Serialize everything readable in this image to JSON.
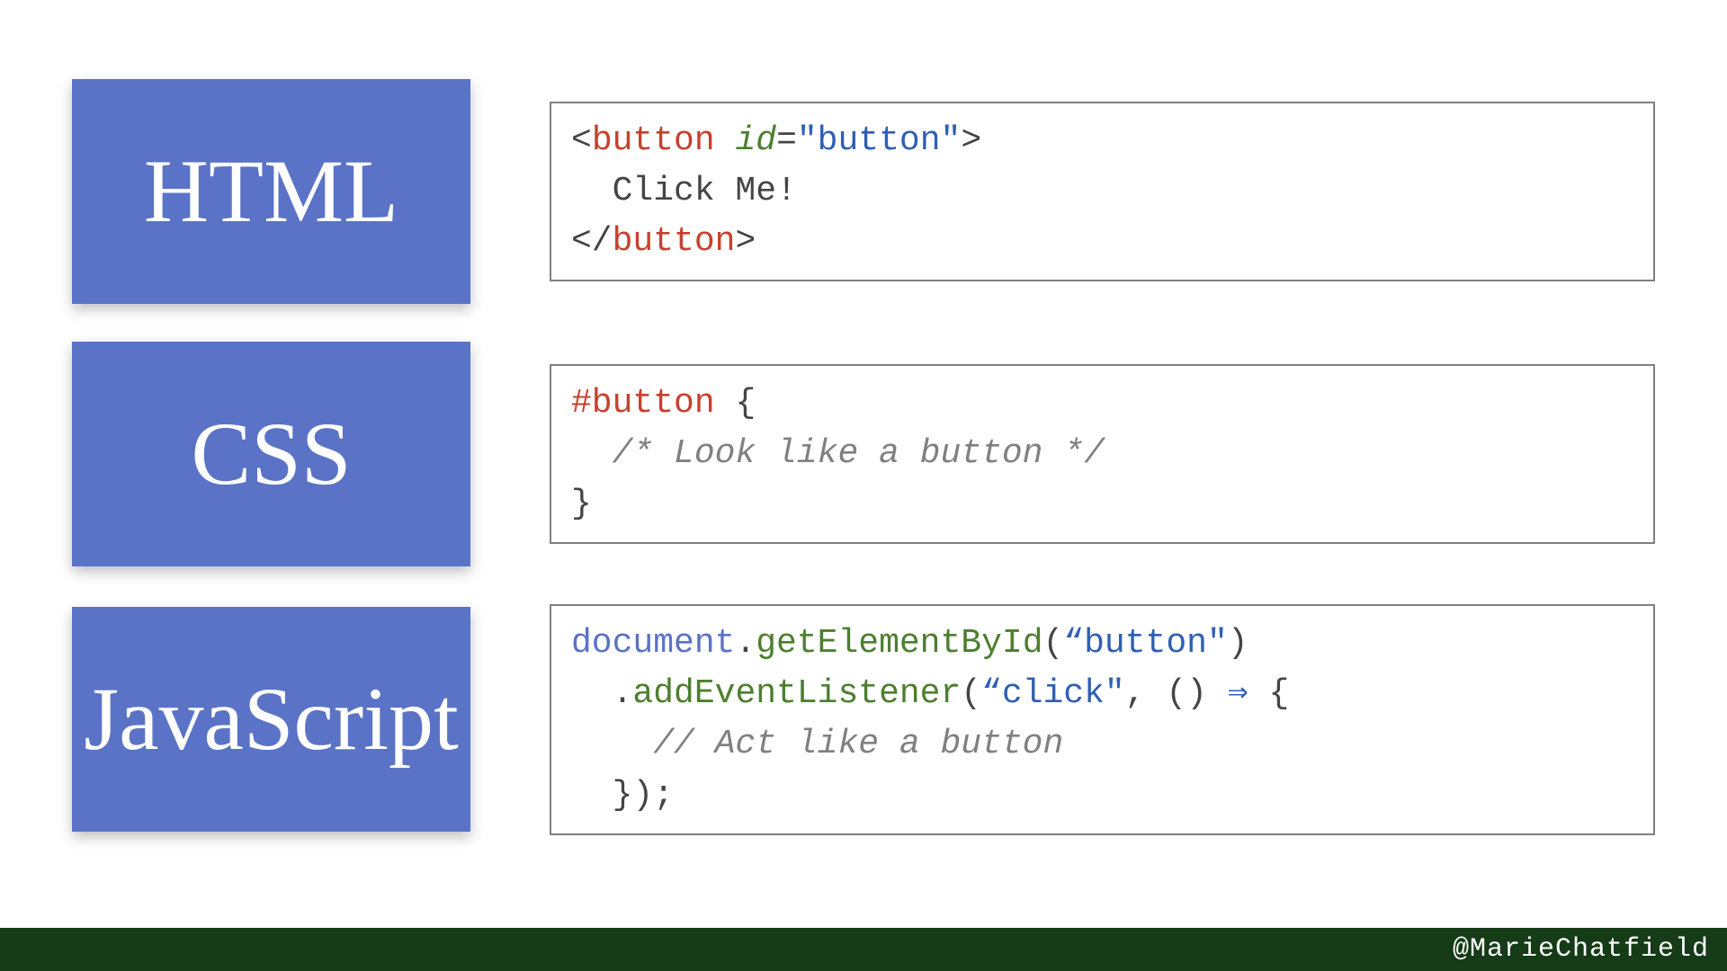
{
  "rows": [
    {
      "label": "HTML"
    },
    {
      "label": "CSS"
    },
    {
      "label": "JavaScript"
    }
  ],
  "code": {
    "html": {
      "lt1": "<",
      "tag_open": "button",
      "space1": " ",
      "attr": "id",
      "eq": "=",
      "str": "\"button\"",
      "gt1": ">",
      "body": "  Click Me!",
      "lt2": "</",
      "tag_close": "button",
      "gt2": ">"
    },
    "css": {
      "selector": "#button",
      "space1": " ",
      "brace_open": "{",
      "comment": "  /* Look like a button */",
      "brace_close": "}"
    },
    "js": {
      "obj": "document",
      "dot1": ".",
      "fn1": "getElementById",
      "p1": "(",
      "arg1": "“button\"",
      "p2": ")",
      "indent1": "  ",
      "dot2": ".",
      "fn2": "addEventListener",
      "p3": "(",
      "arg2": "“click\"",
      "comma": ", ",
      "arrow_args": "()",
      "space2": " ",
      "arrow": "⇒",
      "space3": " ",
      "brace_open": "{",
      "comment": "    // Act like a button",
      "tail": "  });"
    }
  },
  "footer": {
    "handle": "@MarieChatfield"
  }
}
